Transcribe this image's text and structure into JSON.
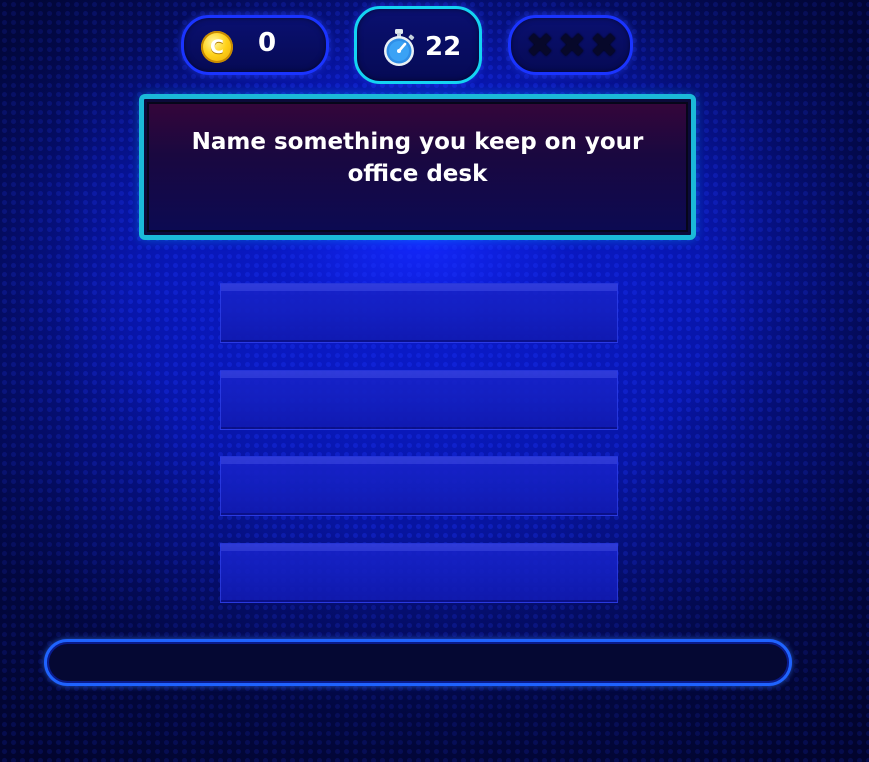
{
  "hud": {
    "coins": {
      "icon": "coin-icon",
      "icon_letter": "C",
      "value": "0"
    },
    "timer": {
      "icon": "stopwatch-icon",
      "value": "22"
    },
    "strikes": {
      "icons": [
        "strike-x-icon",
        "strike-x-icon",
        "strike-x-icon"
      ],
      "glyph": "✖",
      "count": 0
    }
  },
  "question": {
    "text": "Name something you keep on your office desk"
  },
  "answers": {
    "slots": [
      "",
      "",
      "",
      ""
    ]
  },
  "answer_input": {
    "value": "",
    "placeholder": ""
  },
  "colors": {
    "background": "#0a1cc8",
    "timer_border": "#14d4f2",
    "question_border": "#1bb9d8",
    "input_border": "#1f63ff",
    "coin": "#ffd21a"
  }
}
